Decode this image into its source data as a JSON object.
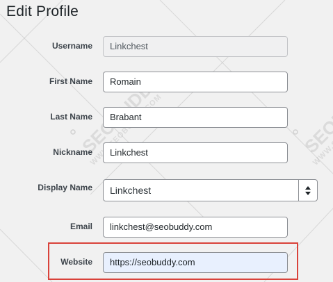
{
  "page": {
    "title": "Edit Profile"
  },
  "watermark": {
    "brand": "SEOBUDDY",
    "url": "WWW.SEOBUDDY.COM"
  },
  "fields": {
    "username": {
      "label": "Username",
      "value": "Linkchest"
    },
    "first_name": {
      "label": "First Name",
      "value": "Romain"
    },
    "last_name": {
      "label": "Last Name",
      "value": "Brabant"
    },
    "nickname": {
      "label": "Nickname",
      "value": "Linkchest"
    },
    "display_name": {
      "label": "Display Name",
      "value": "Linkchest"
    },
    "email": {
      "label": "Email",
      "value": "linkchest@seobuddy.com"
    },
    "website": {
      "label": "Website",
      "value": "https://seobuddy.com"
    }
  },
  "colors": {
    "highlight": "#d9423a",
    "autofill": "#e8f0fe",
    "background": "#f1f1f1"
  },
  "icons": {
    "select_arrows": "up-down-arrows-icon"
  }
}
